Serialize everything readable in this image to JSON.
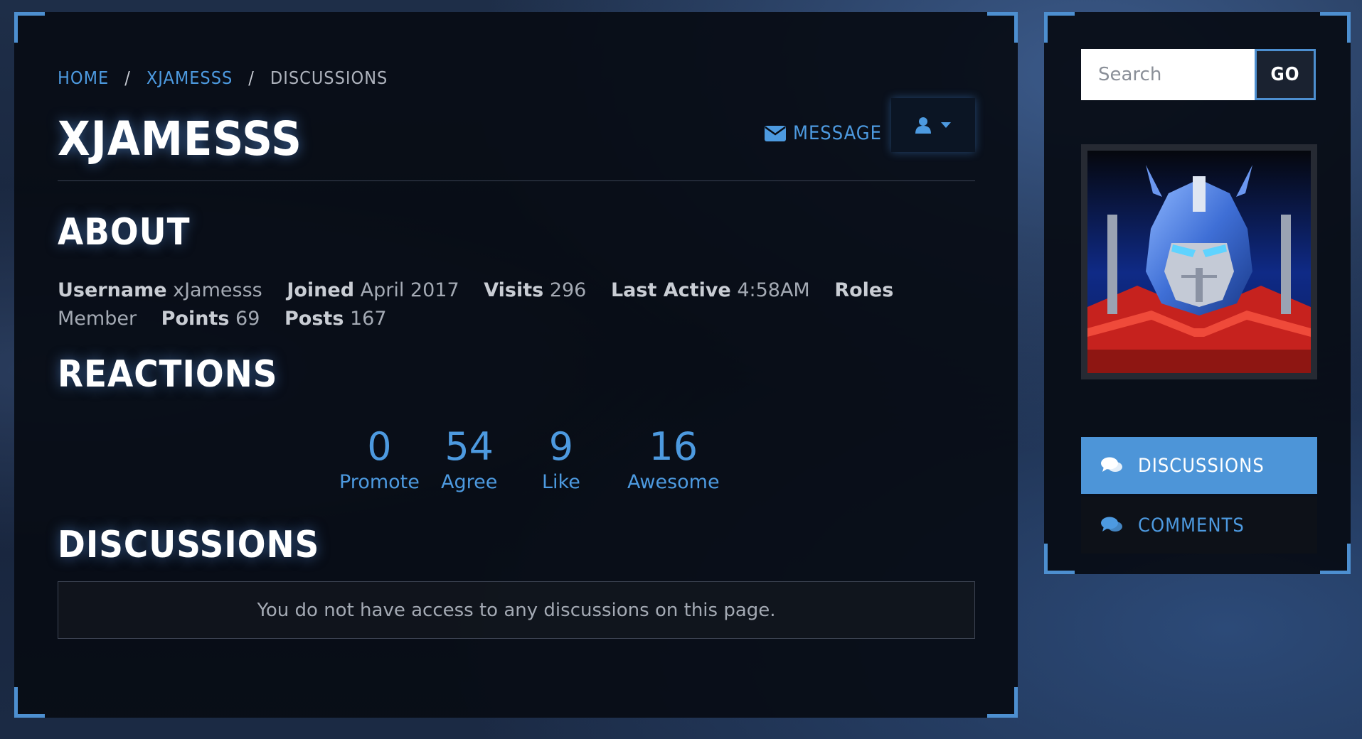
{
  "breadcrumb": {
    "home": "HOME",
    "user": "XJAMESSS",
    "current": "DISCUSSIONS"
  },
  "profile": {
    "title": "XJAMESSS",
    "message_label": "MESSAGE"
  },
  "about": {
    "heading": "ABOUT",
    "fields": [
      {
        "label": "Username",
        "value": "xJamesss"
      },
      {
        "label": "Joined",
        "value": "April 2017"
      },
      {
        "label": "Visits",
        "value": "296"
      },
      {
        "label": "Last Active",
        "value": "4:58AM"
      },
      {
        "label": "Roles",
        "value": "Member"
      },
      {
        "label": "Points",
        "value": "69"
      },
      {
        "label": "Posts",
        "value": "167"
      }
    ]
  },
  "reactions": {
    "heading": "REACTIONS",
    "items": [
      {
        "count": "0",
        "name": "Promote"
      },
      {
        "count": "54",
        "name": "Agree"
      },
      {
        "count": "9",
        "name": "Like"
      },
      {
        "count": "16",
        "name": "Awesome"
      }
    ]
  },
  "discussions": {
    "heading": "DISCUSSIONS",
    "empty_message": "You do not have access to any discussions on this page."
  },
  "sidebar": {
    "search_placeholder": "Search",
    "go_label": "GO",
    "nav": [
      {
        "label": "DISCUSSIONS",
        "icon": "comments-icon",
        "active": true
      },
      {
        "label": "COMMENTS",
        "icon": "comments-icon",
        "active": false
      }
    ]
  },
  "colors": {
    "accent": "#4d9ae0",
    "active_nav": "#4d95d8",
    "panel_bg": "#080c14"
  }
}
